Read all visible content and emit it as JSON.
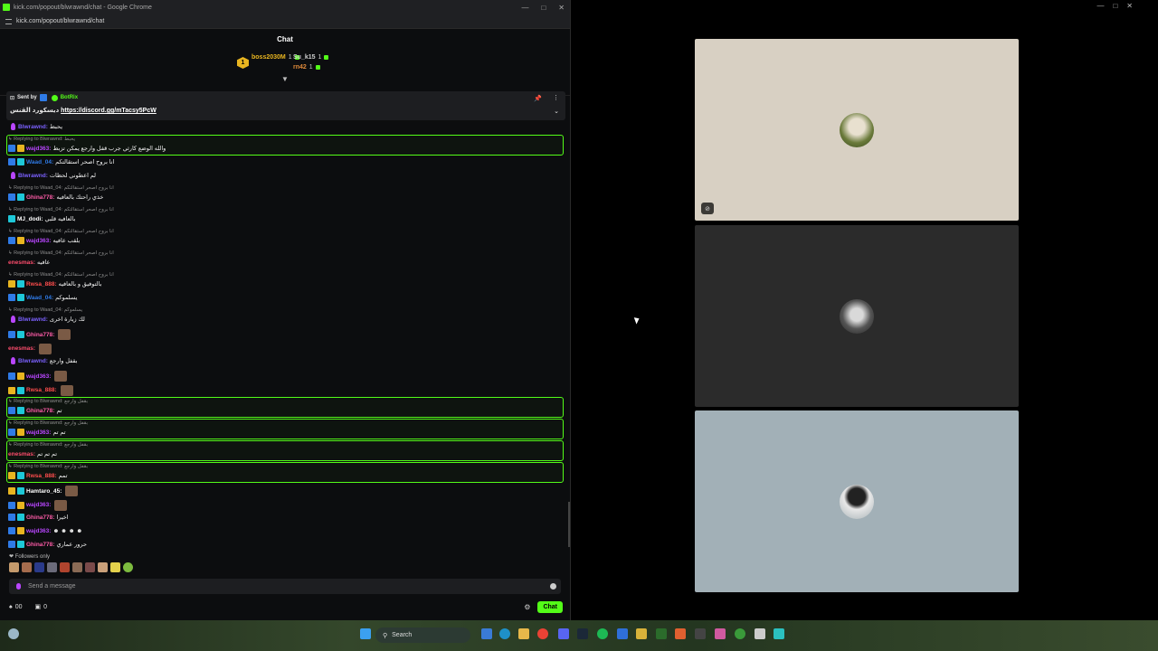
{
  "window": {
    "title": "kick.com/popout/blwrawnd/chat - Google Chrome",
    "url": "kick.com/popout/blwrawnd/chat"
  },
  "chat": {
    "header": "Chat",
    "leaderboard": [
      {
        "name": "boss2030M",
        "count": "1",
        "color": "#e9b520"
      },
      {
        "name": "Su_k15",
        "count": "1",
        "color": "#d0d0d0"
      },
      {
        "name": "rn42",
        "count": "1",
        "color": "#e08a3a"
      }
    ],
    "medal_rank": "1",
    "pinned": {
      "sent_by": "Sent by",
      "sender": "BotRix",
      "prefix": "ديسكورد القنس",
      "link": "https://discord.gg/mTacsy5PcW"
    },
    "messages": [
      {
        "user": "Blwrawnd",
        "color": "#7b61ff",
        "text": "يحبط",
        "badges": [
          "mic"
        ]
      },
      {
        "reply": "Replying to Blwrawnd: يحبط",
        "user": "wajd363",
        "color": "#b946ff",
        "text": "والله الوضع كارثي جرب قفل وارجع يمكن تزبط",
        "badges": [
          "blue",
          "gold"
        ],
        "highlight": true
      },
      {
        "user": "Waad_04",
        "color": "#2f7be7",
        "text": "انا بروح اصحر استقالتكم",
        "badges": [
          "blue",
          "cyan"
        ]
      },
      {
        "user": "Blwrawnd",
        "color": "#7b61ff",
        "text": "لم اعطوني لحظات",
        "badges": [
          "mic"
        ]
      },
      {
        "reply": "Replying to Waad_04: انا بروح اصحر استقالتكم",
        "user": "Ghina778",
        "color": "#ff5ca8",
        "text": "خذي راحتك بالعافيه",
        "badges": [
          "blue",
          "cyan"
        ]
      },
      {
        "reply": "Replying to Waad_04: انا بروح اصحر استقالتكم",
        "user": "MJ_dodi",
        "color": "#ffffff",
        "text": "بالعافيه قلبي",
        "badges": [
          "cyan"
        ]
      },
      {
        "reply": "Replying to Waad_04: انا بروح اصحر استقالتكم",
        "user": "wajd363",
        "color": "#b946ff",
        "text": "بلقب عافيه",
        "badges": [
          "blue",
          "gold"
        ]
      },
      {
        "reply": "Replying to Waad_04: انا بروح اصحر استقالتكم",
        "user": "enesmas",
        "color": "#ff4d6d",
        "text": "عافيه",
        "badges": []
      },
      {
        "reply": "Replying to Waad_04: انا بروح اصحر استقالتكم",
        "user": "Rwsa_888",
        "color": "#ff4d4d",
        "text": "بالتوفيق و بالعافيه",
        "badges": [
          "gold",
          "cyan"
        ]
      },
      {
        "user": "Waad_04",
        "color": "#2f7be7",
        "text": "يسلموكم",
        "badges": [
          "blue",
          "cyan"
        ]
      },
      {
        "reply": "Replying to Waad_04: يسلموكم",
        "user": "Blwrawnd",
        "color": "#7b61ff",
        "text": "لك زيارة اخرى",
        "badges": [
          "mic"
        ]
      },
      {
        "user": "Ghina778",
        "color": "#ff5ca8",
        "text": "",
        "badges": [
          "blue",
          "cyan"
        ],
        "emote": true
      },
      {
        "user": "enesmas",
        "color": "#ff4d6d",
        "text": "",
        "badges": [],
        "emote": true
      },
      {
        "user": "Blwrawnd",
        "color": "#7b61ff",
        "text": "بقفل وارجع",
        "badges": [
          "mic"
        ]
      },
      {
        "user": "wajd363",
        "color": "#b946ff",
        "text": "",
        "badges": [
          "blue",
          "gold"
        ],
        "emote": true
      },
      {
        "user": "Rwsa_888",
        "color": "#ff4d4d",
        "text": "",
        "badges": [
          "gold",
          "cyan"
        ],
        "emote": true
      },
      {
        "reply": "Replying to Blwrawnd: بقفل وارجع",
        "user": "Ghina778",
        "color": "#ff5ca8",
        "text": "تم",
        "badges": [
          "blue",
          "cyan"
        ],
        "highlight": true
      },
      {
        "reply": "Replying to Blwrawnd: بقفل وارجع",
        "user": "wajd363",
        "color": "#b946ff",
        "text": "تم تم",
        "badges": [
          "blue",
          "gold"
        ],
        "highlight": true
      },
      {
        "reply": "Replying to Blwrawnd: بقفل وارجع",
        "user": "enesmas",
        "color": "#ff4d6d",
        "text": "تم تم تم",
        "badges": [],
        "highlight": true
      },
      {
        "reply": "Replying to Blwrawnd: بقفل وارجع",
        "user": "Rwsa_888",
        "color": "#ff4d4d",
        "text": "تمم",
        "badges": [
          "gold",
          "cyan"
        ],
        "highlight": true
      },
      {
        "user": "Hamtaro_45",
        "color": "#ffffff",
        "text": "",
        "badges": [
          "gold",
          "cyan"
        ],
        "emote": true
      },
      {
        "user": "wajd363",
        "color": "#b946ff",
        "text": "",
        "badges": [
          "blue",
          "gold"
        ],
        "emote": true
      },
      {
        "user": "Ghina778",
        "color": "#ff5ca8",
        "text": "اخيرا",
        "badges": [
          "blue",
          "cyan"
        ]
      },
      {
        "user": "wajd363",
        "color": "#b946ff",
        "text": "☻ ☻ ☻ ☻",
        "badges": [
          "blue",
          "gold"
        ]
      },
      {
        "user": "Ghina778",
        "color": "#ff5ca8",
        "text": "حرور عماري",
        "badges": [
          "blue",
          "cyan"
        ]
      }
    ],
    "followers_only": "Followers only",
    "input_placeholder": "Send a message",
    "viewers": "00",
    "gifts": "0",
    "send_label": "Chat"
  },
  "taskbar": {
    "search_placeholder": "Search"
  },
  "colors": {
    "accent": "#53fc18",
    "tile1": "#d8d0c3",
    "tile2": "#2b2b2b",
    "tile3": "#a2b0b7"
  }
}
